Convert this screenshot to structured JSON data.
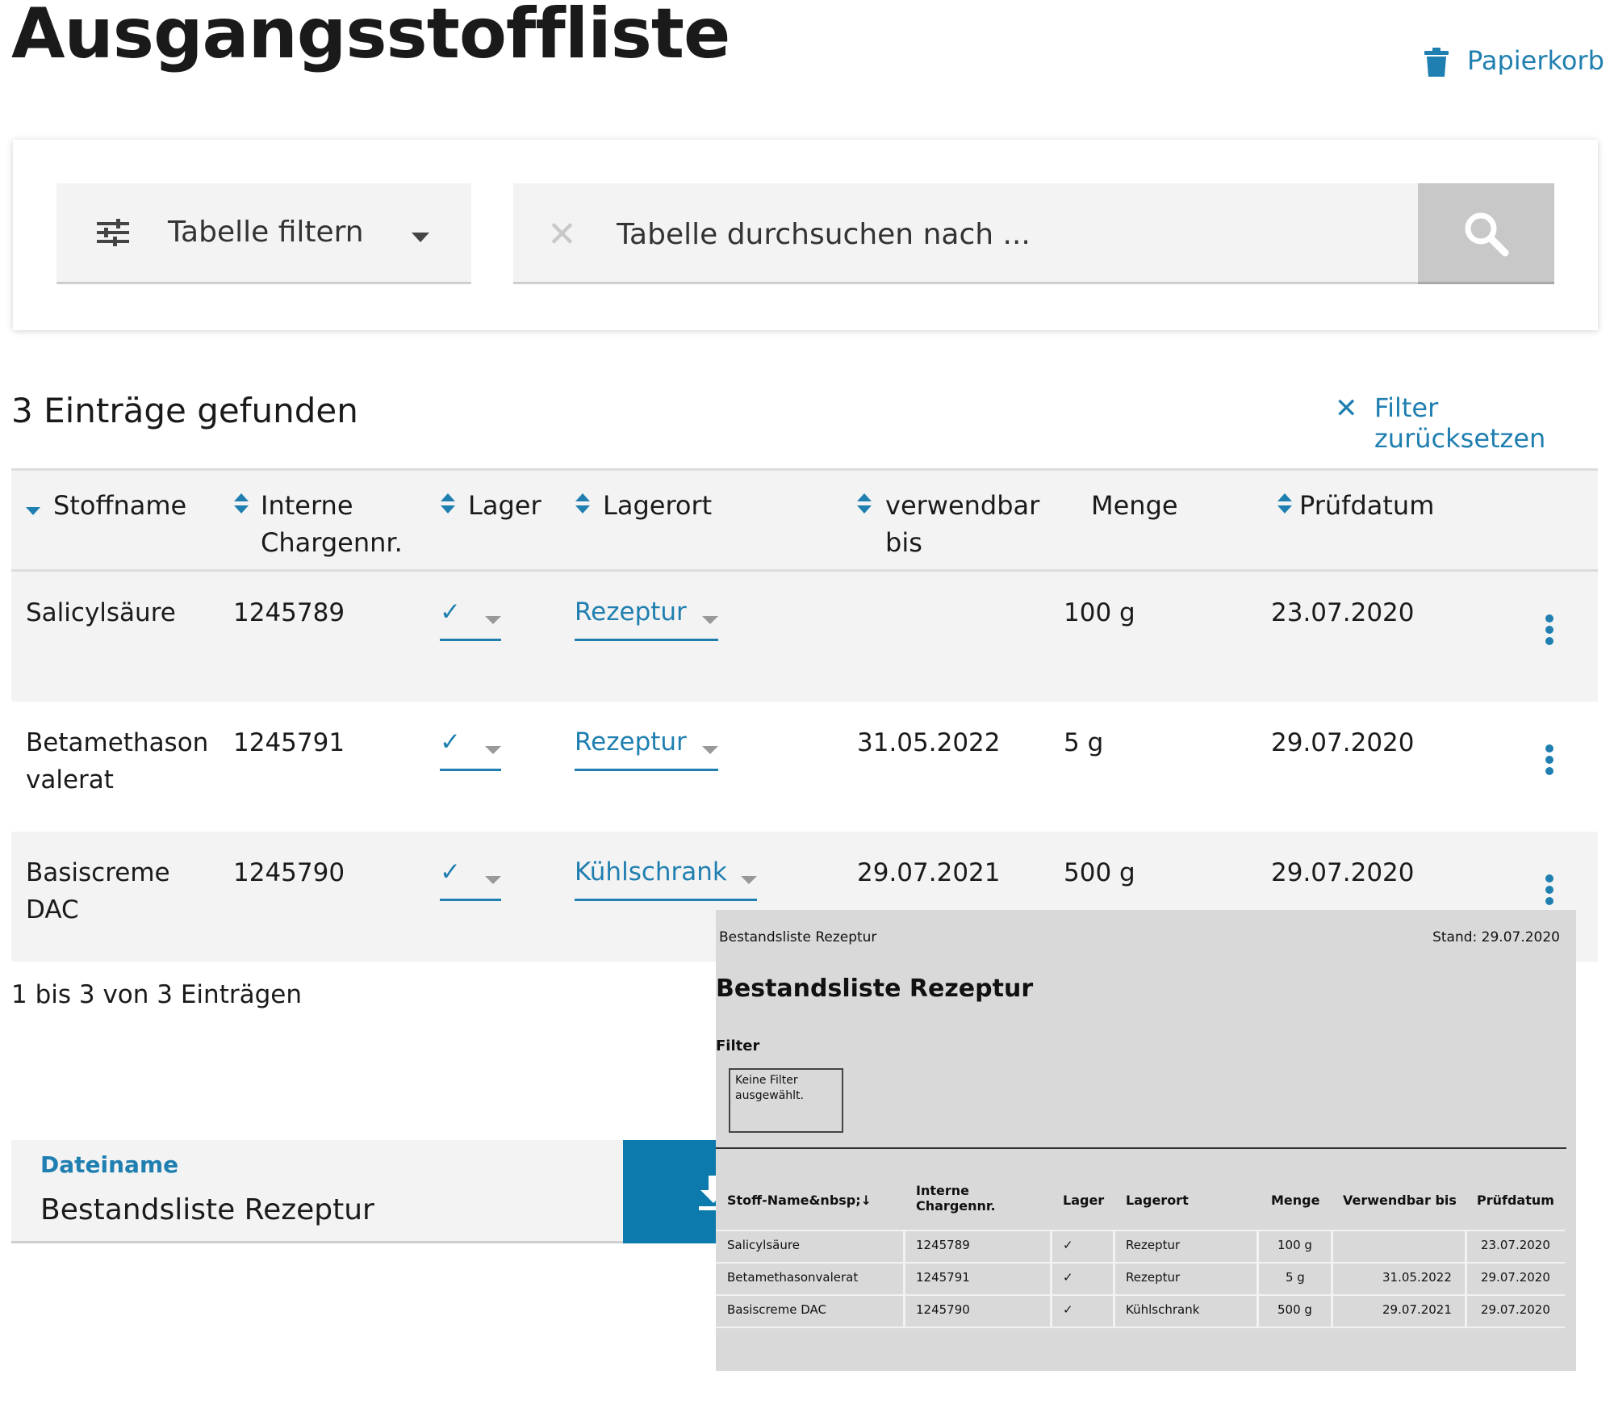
{
  "header": {
    "title": "Ausgangsstoffliste",
    "trash_label": "Papierkorb"
  },
  "filter": {
    "filter_button_label": "Tabelle filtern",
    "search_placeholder": "Tabelle durchsuchen nach ...",
    "search_value": ""
  },
  "results": {
    "count_text": "3 Einträge gefunden",
    "reset_label": "Filter zurücksetzen",
    "paging_text": "1 bis 3 von 3 Einträgen"
  },
  "table": {
    "columns": [
      {
        "label": "Stoffname",
        "sort": "descending"
      },
      {
        "label": "Interne Chargennr.",
        "sort": "both"
      },
      {
        "label": "Lager",
        "sort": "both"
      },
      {
        "label": "Lagerort",
        "sort": "both"
      },
      {
        "label": "verwendbar bis",
        "sort": "both"
      },
      {
        "label": "Menge",
        "sort": "none"
      },
      {
        "label": "Prüfdatum",
        "sort": "both"
      }
    ],
    "rows": [
      {
        "name": "Salicylsäure",
        "charge": "1245789",
        "lager": "✓",
        "lagerort": "Rezeptur",
        "verwendbar": "",
        "menge": "100 g",
        "pruefdatum": "23.07.2020"
      },
      {
        "name": "Betamethason valerat",
        "charge": "1245791",
        "lager": "✓",
        "lagerort": "Rezeptur",
        "verwendbar": "31.05.2022",
        "menge": "5 g",
        "pruefdatum": "29.07.2020"
      },
      {
        "name": "Basiscreme DAC",
        "charge": "1245790",
        "lager": "✓",
        "lagerort": "Kühlschrank",
        "verwendbar": "29.07.2021",
        "menge": "500 g",
        "pruefdatum": "29.07.2020"
      }
    ]
  },
  "export": {
    "filename_label": "Dateiname",
    "filename_value": "Bestandsliste Rezeptur"
  },
  "preview": {
    "header_left": "Bestandsliste Rezeptur",
    "header_right": "Stand: 29.07.2020",
    "title": "Bestandsliste Rezeptur",
    "filter_label": "Filter",
    "filter_text": "Keine Filter ausgewählt.",
    "columns": [
      "Stoff-Name&nbsp;↓",
      "Interne Chargennr.",
      "Lager",
      "Lagerort",
      "Menge",
      "Verwendbar bis",
      "Prüfdatum"
    ],
    "rows": [
      [
        "Salicylsäure",
        "1245789",
        "✓",
        "Rezeptur",
        "100 g",
        "",
        "23.07.2020"
      ],
      [
        "Betamethasonvalerat",
        "1245791",
        "✓",
        "Rezeptur",
        "5 g",
        "31.05.2022",
        "29.07.2020"
      ],
      [
        "Basiscreme DAC",
        "1245790",
        "✓",
        "Kühlschrank",
        "500 g",
        "29.07.2021",
        "29.07.2020"
      ]
    ]
  },
  "colors": {
    "accent": "#1f7fb0",
    "download_button": "#0c7aac",
    "row_shade": "#f3f3f3"
  },
  "icons": {
    "trash": "trash-icon",
    "filter": "sliders-icon",
    "search": "search-icon",
    "clear": "close-icon",
    "download": "download-icon",
    "more": "kebab-menu-icon"
  }
}
